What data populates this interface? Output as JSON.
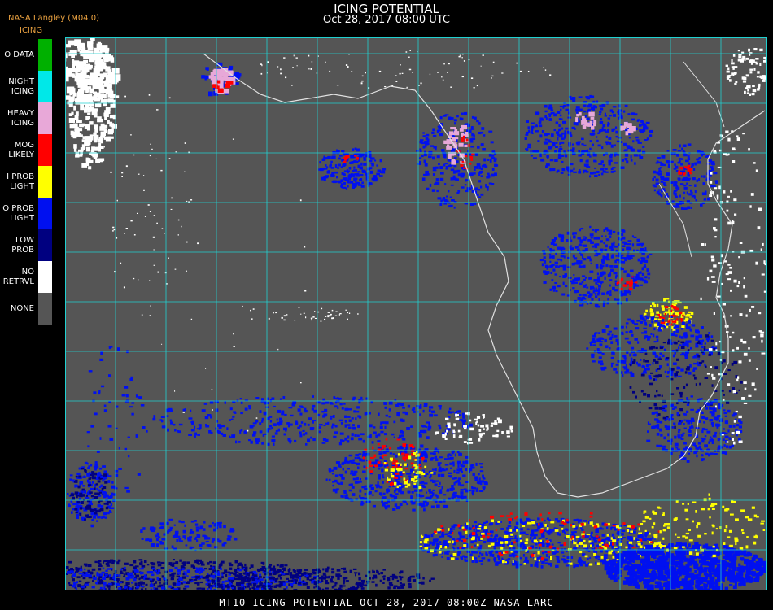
{
  "header": {
    "title": "ICING POTENTIAL",
    "subtitle": "Oct 28, 2017 08:00 UTC",
    "provider": "NASA Langley (M04.0)",
    "legend_title": "ICING"
  },
  "legend": [
    {
      "label": "O DATA",
      "color": "#00b000"
    },
    {
      "label": "NIGHT\nICING",
      "color": "#00e8e8"
    },
    {
      "label": "HEAVY\nICING",
      "color": "#e8a8d8"
    },
    {
      "label": "MOG\nLIKELY",
      "color": "#ff0000"
    },
    {
      "label": "I PROB\nLIGHT",
      "color": "#ffff00"
    },
    {
      "label": "O PROB\nLIGHT",
      "color": "#0010f0"
    },
    {
      "label": "LOW\nPROB",
      "color": "#000080"
    },
    {
      "label": "NO\nRETRVL",
      "color": "#ffffff"
    },
    {
      "label": "NONE",
      "color": "#555555"
    }
  ],
  "map": {
    "background": "#555555",
    "grid_color": "#20d0d0",
    "coast_color": "#e0e0e0",
    "grid_label_color": "#c02020"
  },
  "footer": "MT10  ICING POTENTIAL   OCT 28, 2017 08:00Z   NASA LARC"
}
